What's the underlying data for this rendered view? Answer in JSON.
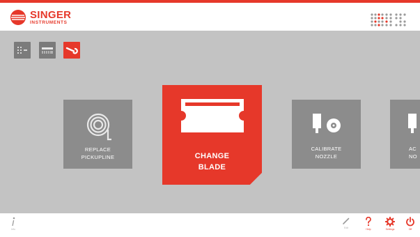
{
  "header": {
    "brand_name": "SINGER",
    "brand_sub": "INSTRUMENTS",
    "accent_color": "#e6382a"
  },
  "mode_buttons": [
    {
      "icon": "array-icon",
      "selected": false
    },
    {
      "icon": "plate-icon",
      "selected": false
    },
    {
      "icon": "wrench-icon",
      "selected": true
    }
  ],
  "tiles": [
    {
      "icon": "pickupline-coil-icon",
      "label": "REPLACE\nPICKUPLINE",
      "selected": false
    },
    {
      "icon": "blade-icon",
      "label": "CHANGE\nBLADE",
      "selected": true
    },
    {
      "icon": "nozzle-calibrate-icon",
      "label": "CALIBRATE\nNOZZLE",
      "selected": false
    },
    {
      "icon": "nozzle-icon",
      "label": "AC\nNO",
      "selected": false
    }
  ],
  "footer": {
    "info_label": "Info",
    "items": [
      {
        "icon": "pencil-icon",
        "label": "Edit",
        "color": "#9a9a9a"
      },
      {
        "icon": "question-icon",
        "label": "Help",
        "color": "#e6382a"
      },
      {
        "icon": "gear-icon",
        "label": "Settings",
        "color": "#e6382a"
      },
      {
        "icon": "power-icon",
        "label": "Off",
        "color": "#e6382a"
      }
    ]
  }
}
